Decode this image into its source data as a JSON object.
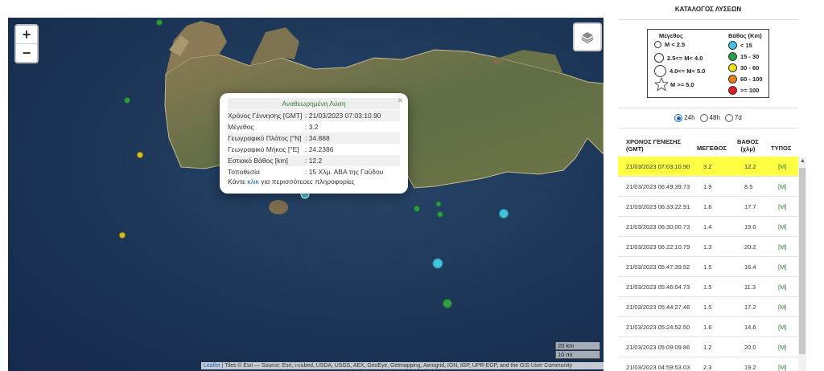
{
  "map": {
    "zoom_in": "+",
    "zoom_out": "−",
    "colors": {
      "lt15": "#40c4dc",
      "d15_30": "#2e9e44",
      "d30_60": "#d8c21e"
    },
    "markers": [
      {
        "color_key": "d15_30"
      },
      {
        "color_key": "d15_30"
      },
      {
        "color_key": "d30_60"
      },
      {
        "color_key": "d30_60"
      },
      {
        "color_key": "lt15",
        "selected": true
      },
      {
        "color_key": "d15_30"
      },
      {
        "color_key": "d15_30"
      },
      {
        "color_key": "d15_30"
      },
      {
        "color_key": "lt15"
      },
      {
        "color_key": "lt15"
      },
      {
        "color_key": "d15_30"
      }
    ],
    "scale": {
      "km": "20 km",
      "mi": "10 mi"
    },
    "attribution_link": "Leaflet",
    "attribution_text": " | Tiles © Esri — Source: Esri, i-cubed, USDA, USGS, AEX, GeoEye, Getmapping, Aerogrid, IGN, IGP, UPR-EGP, and the GIS User Community"
  },
  "popup": {
    "title": "Αναθεωρημένη Λύση",
    "rows": [
      {
        "k": "Χρόνος Γέννησης [GMT]",
        "v": ": 21/03/2023 07:03:10.90"
      },
      {
        "k": "Μέγεθος",
        "v": ": 3.2"
      },
      {
        "k": "Γεωγραφικό Πλάτος [°N]",
        "v": ": 34.888"
      },
      {
        "k": "Γεωγραφικό Μήκος [°E]",
        "v": ": 24.2386"
      },
      {
        "k": "Εστιακό Βάθος [km]",
        "v": ": 12.2"
      },
      {
        "k": "Τοποθεσία",
        "v": ": 15 Χλμ. ΑΒΑ της Γαύδου"
      }
    ],
    "more_prefix": "Κάντε ",
    "more_link": "κλικ",
    "more_suffix": " για περισσότερες πληροφορίες",
    "close": "×"
  },
  "catalog": {
    "title": "ΚΑΤΑΛΟΓΟΣ ΛΥΣΕΩΝ",
    "legend": {
      "mag_header": "Μέγεθος",
      "depth_header": "Βάθος (Km)",
      "mag_items": [
        "M < 2.5",
        "2.5<= M< 4.0",
        "4.0<= M< 5.0",
        "M >= 5.0"
      ],
      "depth_items": [
        {
          "label": "< 15",
          "color": "#40c4dc"
        },
        {
          "label": "15 - 30",
          "color": "#2e9e44"
        },
        {
          "label": "30 - 60",
          "color": "#f0e020"
        },
        {
          "label": "60 - 100",
          "color": "#ef7f1a"
        },
        {
          "label": ">= 100",
          "color": "#e02020"
        }
      ]
    },
    "periods": [
      "24h",
      "48h",
      "7d"
    ],
    "selected_period": "24h",
    "headers": {
      "time1": "ΧΡΟΝΟΣ ΓΕΝΕΣΗΣ",
      "time2": "(GMT)",
      "mag": "ΜΕΓΕΘΟΣ",
      "depth1": "ΒΑΘΟΣ",
      "depth2": "(χλμ)",
      "type": "ΤΥΠΟΣ"
    },
    "rows": [
      {
        "time": "21/03/2023 07:03:10.90",
        "mag": "3.2",
        "depth": "12.2",
        "type": "[M]",
        "selected": true
      },
      {
        "time": "21/03/2023 06:49:39.73",
        "mag": "1.9",
        "depth": "8.5",
        "type": "[M]"
      },
      {
        "time": "21/03/2023 06:33:22.91",
        "mag": "1.6",
        "depth": "17.7",
        "type": "[M]"
      },
      {
        "time": "21/03/2023 06:30:00.73",
        "mag": "1.4",
        "depth": "19.0",
        "type": "[M]"
      },
      {
        "time": "21/03/2023 06:22:10.79",
        "mag": "1.3",
        "depth": "20.2",
        "type": "[M]"
      },
      {
        "time": "21/03/2023 05:47:39.52",
        "mag": "1.5",
        "depth": "16.4",
        "type": "[M]"
      },
      {
        "time": "21/03/2023 05:46:04.73",
        "mag": "1.5",
        "depth": "11.3",
        "type": "[M]"
      },
      {
        "time": "21/03/2023 05:44:27.46",
        "mag": "1.5",
        "depth": "17.2",
        "type": "[M]"
      },
      {
        "time": "21/03/2023 05:24:52.50",
        "mag": "1.6",
        "depth": "14.6",
        "type": "[M]"
      },
      {
        "time": "21/03/2023 05:09:09.86",
        "mag": "1.2",
        "depth": "20.0",
        "type": "[M]"
      },
      {
        "time": "21/03/2023 04:59:53.03",
        "mag": "2.3",
        "depth": "19.2",
        "type": "[M]"
      }
    ]
  }
}
